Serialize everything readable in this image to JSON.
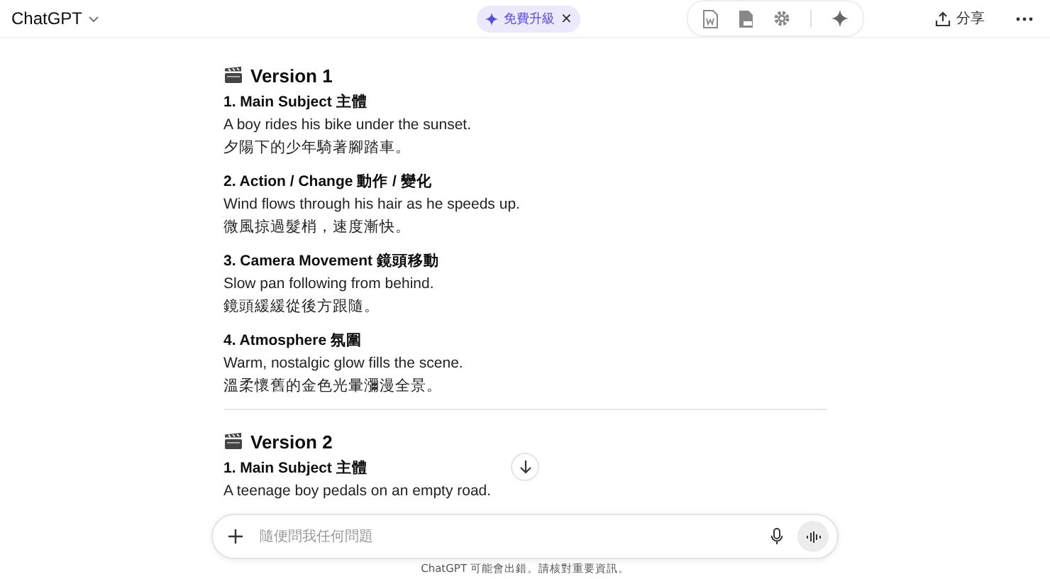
{
  "header": {
    "title": "ChatGPT",
    "upgrade_badge": "免費升級",
    "close_glyph": "×",
    "share": "分享"
  },
  "versions": [
    {
      "title": "Version 1",
      "sections": [
        {
          "heading": "1. Main Subject 主體",
          "english": "A boy rides his bike under the sunset.",
          "chinese": "夕陽下的少年騎著腳踏車。"
        },
        {
          "heading": "2. Action / Change 動作 / 變化",
          "english": "Wind flows through his hair as he speeds up.",
          "chinese": "微風掠過髮梢，速度漸快。"
        },
        {
          "heading": "3. Camera Movement 鏡頭移動",
          "english": "Slow pan following from behind.",
          "chinese": "鏡頭緩緩從後方跟隨。"
        },
        {
          "heading": "4. Atmosphere 氛圍",
          "english": "Warm, nostalgic glow fills the scene.",
          "chinese": "溫柔懷舊的金色光暈瀰漫全景。"
        }
      ]
    },
    {
      "title": "Version 2",
      "sections": [
        {
          "heading": "1. Main Subject 主體",
          "english": "A teenage boy pedals on an empty road."
        }
      ]
    }
  ],
  "composer": {
    "placeholder": "隨便問我任何問題"
  },
  "footer": "ChatGPT 可能會出錯。請核對重要資訊。"
}
